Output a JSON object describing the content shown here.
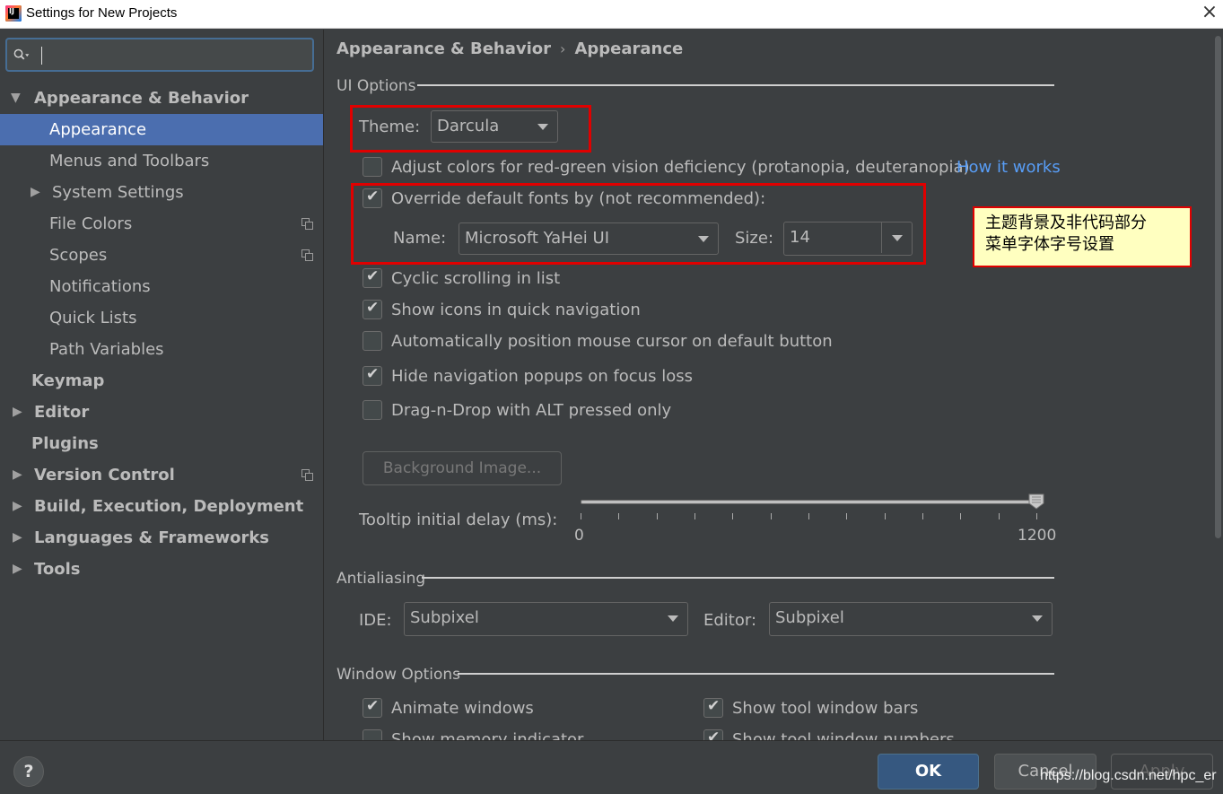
{
  "window": {
    "logo_text": "IJ",
    "title": "Settings for New Projects",
    "close_glyph": "×"
  },
  "sidebar": {
    "search": {
      "value": ""
    },
    "items": [
      {
        "label": "Appearance & Behavior",
        "arrow": "▼"
      },
      {
        "label": "Appearance"
      },
      {
        "label": "Menus and Toolbars"
      },
      {
        "label": "System Settings",
        "arrow": "▶"
      },
      {
        "label": "File Colors",
        "icon": "copy-icon"
      },
      {
        "label": "Scopes",
        "icon": "copy-icon"
      },
      {
        "label": "Notifications"
      },
      {
        "label": "Quick Lists"
      },
      {
        "label": "Path Variables"
      },
      {
        "label": "Keymap"
      },
      {
        "label": "Editor",
        "arrow": "▶"
      },
      {
        "label": "Plugins"
      },
      {
        "label": "Version Control",
        "arrow": "▶",
        "icon": "copy-icon"
      },
      {
        "label": "Build, Execution, Deployment",
        "arrow": "▶"
      },
      {
        "label": "Languages & Frameworks",
        "arrow": "▶"
      },
      {
        "label": "Tools",
        "arrow": "▶"
      }
    ]
  },
  "breadcrumb": {
    "parent": "Appearance & Behavior",
    "separator": "›",
    "current": "Appearance"
  },
  "ui_options": {
    "section_title": "UI Options",
    "theme_label": "Theme:",
    "theme_value": "Darcula",
    "adjust_colors": {
      "label": "Adjust colors for red-green vision deficiency (protanopia, deuteranopia)",
      "checked": false
    },
    "how_it_works": "How it works",
    "override_fonts": {
      "label": "Override default fonts by (not recommended):",
      "checked": true
    },
    "font_name_label": "Name:",
    "font_name_value": "Microsoft YaHei UI",
    "font_size_label": "Size:",
    "font_size_value": "14",
    "cyclic_scrolling": {
      "label": "Cyclic scrolling in list",
      "checked": true
    },
    "show_icons": {
      "label": "Show icons in quick navigation",
      "checked": true
    },
    "auto_position": {
      "label": "Automatically position mouse cursor on default button",
      "checked": false
    },
    "hide_popups": {
      "label": "Hide navigation popups on focus loss",
      "checked": true
    },
    "drag_n_drop": {
      "label": "Drag-n-Drop with ALT pressed only",
      "checked": false
    },
    "background_image_button": "Background Image...",
    "tooltip_label": "Tooltip initial delay (ms):",
    "tooltip_min": "0",
    "tooltip_max": "1200",
    "tooltip_value": 1200
  },
  "annotation": {
    "callout_text_line1": "主题背景及非代码部分",
    "callout_text_line2": "菜单字体字号设置",
    "highlight_color": "#e00000"
  },
  "antialiasing": {
    "section_title": "Antialiasing",
    "ide_label": "IDE:",
    "ide_value": "Subpixel",
    "editor_label": "Editor:",
    "editor_value": "Subpixel"
  },
  "window_options": {
    "section_title": "Window Options",
    "animate_windows": {
      "label": "Animate windows",
      "checked": true
    },
    "show_tool_window_bars": {
      "label": "Show tool window bars",
      "checked": true
    },
    "show_memory_indicator": {
      "label": "Show memory indicator",
      "checked": false
    },
    "show_tool_window_numbers": {
      "label": "Show tool window numbers",
      "checked": true
    }
  },
  "buttons": {
    "help": "?",
    "ok": "OK",
    "cancel": "Cancel",
    "apply": "Apply"
  },
  "watermark": "https://blog.csdn.net/hpc_er",
  "colors": {
    "background": "#3c3f41",
    "selection": "#4b6eaf",
    "link": "#589df6",
    "ok_button": "#365880"
  }
}
